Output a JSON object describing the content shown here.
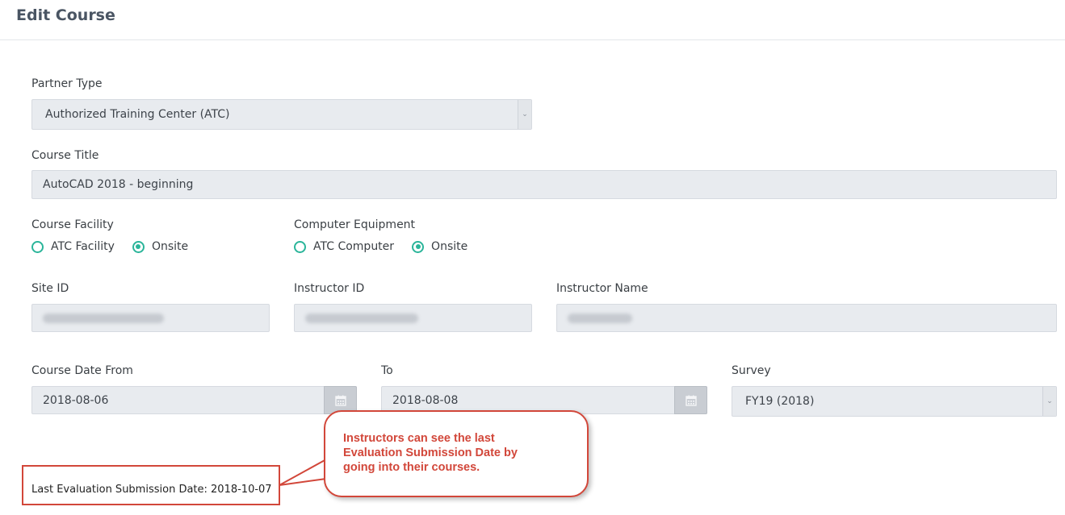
{
  "header": {
    "title": "Edit Course"
  },
  "form": {
    "partner_type": {
      "label": "Partner Type",
      "value": "Authorized Training Center (ATC)"
    },
    "course_title": {
      "label": "Course Title",
      "value": "AutoCAD 2018 - beginning"
    },
    "course_facility": {
      "label": "Course Facility",
      "options": [
        {
          "label": "ATC Facility",
          "checked": false
        },
        {
          "label": "Onsite",
          "checked": true
        }
      ]
    },
    "computer_equipment": {
      "label": "Computer Equipment",
      "options": [
        {
          "label": "ATC Computer",
          "checked": false
        },
        {
          "label": "Onsite",
          "checked": true
        }
      ]
    },
    "site_id": {
      "label": "Site ID"
    },
    "instructor_id": {
      "label": "Instructor ID"
    },
    "instructor_name": {
      "label": "Instructor Name"
    },
    "course_date_from": {
      "label": "Course Date From",
      "value": "2018-08-06"
    },
    "course_date_to": {
      "label": "To",
      "value": "2018-08-08"
    },
    "survey": {
      "label": "Survey",
      "value": "FY19 (2018)"
    }
  },
  "last_evaluation": {
    "text": "Last Evaluation Submission Date: 2018-10-07"
  },
  "callout": {
    "lines": [
      "Instructors can see the last",
      "Evaluation Submission Date by",
      "going into their courses."
    ]
  },
  "colors": {
    "accent": "#2bb59a",
    "callout": "#d2473a",
    "field_bg": "#e8ebef"
  },
  "icons": {
    "select": "chevron-down-icon",
    "date": "calendar-icon"
  }
}
